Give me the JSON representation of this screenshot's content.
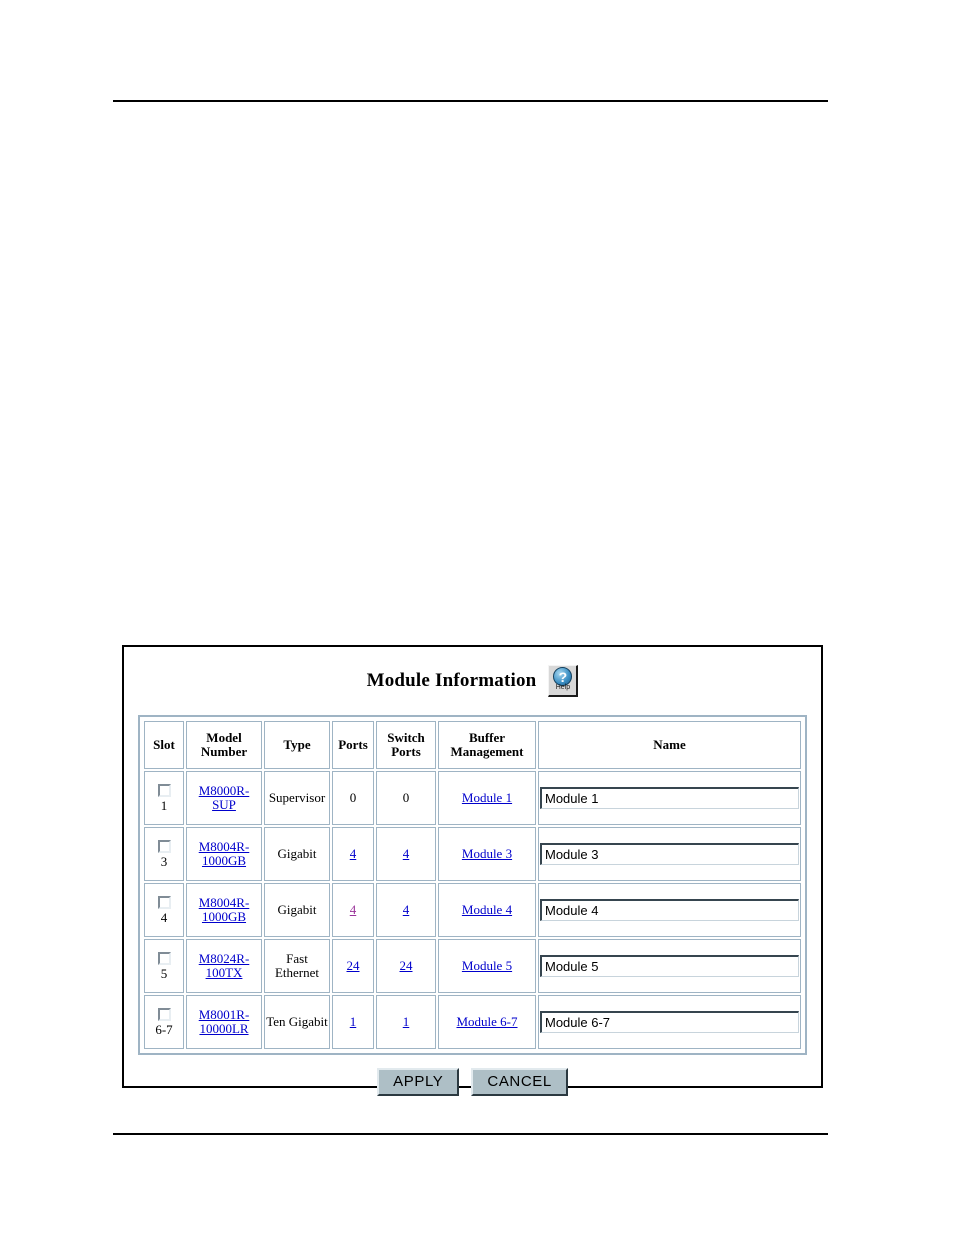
{
  "panel": {
    "title": "Module Information",
    "help_icon_label": "Help",
    "help_icon_glyph": "?"
  },
  "table": {
    "headers": {
      "slot": "Slot",
      "model_number": "Model Number",
      "type": "Type",
      "ports": "Ports",
      "switch_ports": "Switch Ports",
      "buffer_management": "Buffer Management",
      "name": "Name"
    },
    "rows": [
      {
        "slot": "1",
        "model_number": "M8000R-SUP",
        "type": "Supervisor",
        "ports": "0",
        "ports_is_link": false,
        "switch_ports": "0",
        "switch_ports_is_link": false,
        "buffer_management": "Module 1",
        "name_value": "Module 1",
        "checked": false
      },
      {
        "slot": "3",
        "model_number": "M8004R-1000GB",
        "type": "Gigabit",
        "ports": "4",
        "ports_is_link": true,
        "switch_ports": "4",
        "switch_ports_is_link": true,
        "buffer_management": "Module 3",
        "name_value": "Module 3",
        "checked": false
      },
      {
        "slot": "4",
        "model_number": "M8004R-1000GB",
        "type": "Gigabit",
        "ports": "4",
        "ports_is_link": true,
        "ports_visited": true,
        "switch_ports": "4",
        "switch_ports_is_link": true,
        "buffer_management": "Module 4",
        "name_value": "Module 4",
        "checked": false
      },
      {
        "slot": "5",
        "model_number": "M8024R-100TX",
        "type": "Fast Ethernet",
        "ports": "24",
        "ports_is_link": true,
        "switch_ports": "24",
        "switch_ports_is_link": true,
        "buffer_management": "Module 5",
        "name_value": "Module 5",
        "checked": false
      },
      {
        "slot": "6-7",
        "model_number": "M8001R-10000LR",
        "type": "Ten Gigabit",
        "ports": "1",
        "ports_is_link": true,
        "switch_ports": "1",
        "switch_ports_is_link": true,
        "buffer_management": "Module 6-7",
        "name_value": "Module 6-7",
        "checked": false
      }
    ]
  },
  "buttons": {
    "apply": "APPLY",
    "cancel": "CANCEL"
  },
  "colors": {
    "link": "#0000cc",
    "visited_link": "#993399",
    "table_border": "#9fb4c4",
    "button_face": "#aebfc6",
    "frame": "#000000"
  }
}
